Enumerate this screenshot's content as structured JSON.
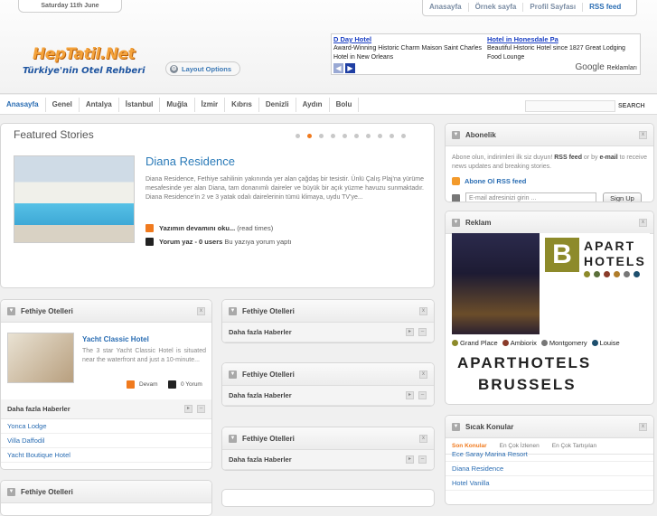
{
  "header": {
    "date": "Saturday 11th June",
    "top_links": [
      "Anasayfa",
      "Örnek sayfa",
      "Profil Sayfası",
      "RSS feed"
    ],
    "logo_title": "HepTatil.Net",
    "logo_subtitle": "Türkiye'nin Otel Rehberi",
    "layout_options": "Layout Options"
  },
  "ads": {
    "ad1": {
      "title": "D Day Hotel",
      "text": "Award-Winning Historic Charm Maison Saint Charles Hotel in New Orleans"
    },
    "ad2": {
      "title": "Hotel in Honesdale Pa",
      "text": "Beautiful Historic Hotel since 1827 Great Lodging Food Lounge"
    },
    "google": "Google",
    "reklamlari": "Reklamları"
  },
  "nav": {
    "items": [
      "Anasayfa",
      "Genel",
      "Antalya",
      "İstanbul",
      "Muğla",
      "İzmir",
      "Kıbrıs",
      "Denizli",
      "Aydın",
      "Bolu"
    ],
    "search_button": "SEARCH"
  },
  "featured": {
    "heading": "Featured Stories",
    "title": "Diana Residence",
    "description": "Diana Residence, Fethiye sahilinin yakınında yer alan çağdaş bir tesistir. Ünlü Çalış Plaj'na yürüme mesafesinde yer alan Diana, tam donanımlı daireler ve büyük bir açık yüzme havuzu sunmaktadır. Diana Residence'in 2 ve 3 yatak odalı dairelerinin tümü klimaya, uydu TV'ye...",
    "read_more": "Yazımın devamını oku...",
    "read_times": "(read times)",
    "comment_label": "Yorum yaz - 0 users",
    "comment_suffix": "Bu yazıya yorum yaptı"
  },
  "box1": {
    "title": "Fethiye Otelleri",
    "hotel_title": "Yacht Classic Hotel",
    "hotel_desc": "The 3 star Yacht Classic Hotel is situated near the waterfront and just a 10-minute...",
    "devam": "Devam",
    "yorum": "0 Yorum",
    "more": "Daha fazla Haberler",
    "links": [
      "Yonca Lodge",
      "Villa Daffodil",
      "Yacht Boutique Hotel"
    ]
  },
  "box_left_bottom": {
    "title": "Fethiye Otelleri"
  },
  "mid_boxes": [
    {
      "title": "Fethiye Otelleri",
      "more": "Daha fazla Haberler"
    },
    {
      "title": "Fethiye Otelleri",
      "more": "Daha fazla Haberler"
    },
    {
      "title": "Fethiye Otelleri",
      "more": "Daha fazla Haberler"
    }
  ],
  "abonelik": {
    "title": "Abonelik",
    "text1": "Abone olun, indirimleri ilk siz duyun!",
    "rss_word": "RSS feed",
    "text2": "or by",
    "email_word": "e-mail",
    "text3": "to receive news updates and breaking stories.",
    "rss_link": "Abone Ol RSS feed",
    "email_placeholder": "E-mail adresinizi girin ...",
    "signup": "Sign Up"
  },
  "reklam": {
    "title": "Reklam",
    "brand_line1": "APART",
    "brand_line2": "HOTELS",
    "locations": [
      "Grand Place",
      "Ambiorix",
      "Montgomery",
      "Louise"
    ],
    "location_colors": [
      "#8d8a2a",
      "#8a3b2a",
      "#777777",
      "#1d4f6e"
    ],
    "big1": "APARTHOTELS",
    "big2": "BRUSSELS"
  },
  "sicak": {
    "title": "Sıcak Konular",
    "tabs": [
      "Son Konular",
      "En Çok İzlenen",
      "En Çok Tartışılan"
    ],
    "links": [
      "Ece Saray Marina Resort",
      "Diana Residence",
      "Hotel Vanilla"
    ]
  }
}
